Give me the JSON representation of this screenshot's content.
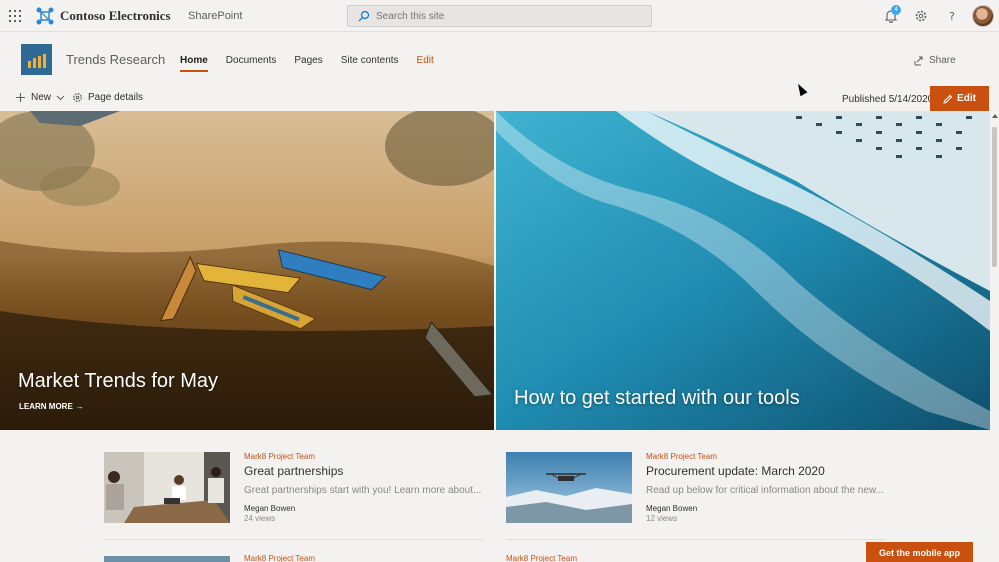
{
  "suitebar": {
    "brand": "Contoso Electronics",
    "app": "SharePoint",
    "search_placeholder": "Search this site",
    "notification_count": "4"
  },
  "site": {
    "title": "Trends Research",
    "nav": [
      {
        "label": "Home"
      },
      {
        "label": "Documents"
      },
      {
        "label": "Pages"
      },
      {
        "label": "Site contents"
      },
      {
        "label": "Edit"
      }
    ],
    "share_label": "Share"
  },
  "commandbar": {
    "new_label": "New",
    "details_label": "Page details",
    "published": "Published 5/14/2020",
    "edit_label": "Edit"
  },
  "hero": {
    "left_title": "Market Trends for May",
    "learn_more": "LEARN MORE",
    "right_title": "How to get started with our tools"
  },
  "news": [
    {
      "category": "Mark8 Project Team",
      "title": "Great partnerships",
      "description": "Great partnerships start with you!  Learn more about...",
      "author": "Megan Bowen",
      "views": "24 views"
    },
    {
      "category": "Mark8 Project Team",
      "title": "Procurement update: March 2020",
      "description": "Read up below for critical information about the new...",
      "author": "Megan Bowen",
      "views": "12 views"
    }
  ],
  "news_next": [
    {
      "category": "Mark8 Project Team"
    },
    {
      "category": "Mark8 Project Team"
    }
  ],
  "mobile_button": "Get the mobile app",
  "colors": {
    "accent": "#ca5010",
    "logo_bg": "#2f6a94",
    "page_bg": "#f3f2f1"
  }
}
